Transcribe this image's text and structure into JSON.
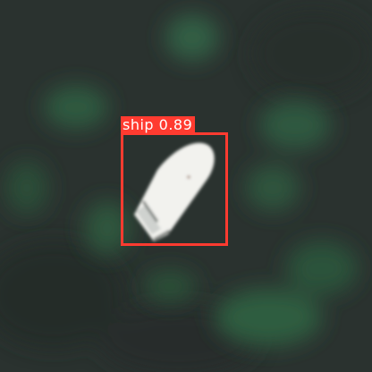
{
  "detection": {
    "label": "ship 0.89",
    "class": "ship",
    "confidence": 0.89,
    "box_color": "#ff3b30"
  },
  "scene": {
    "water_color": "#2a322f",
    "vegetation_color": "#2f5a3e",
    "boat_color": "#f2f2ee"
  }
}
